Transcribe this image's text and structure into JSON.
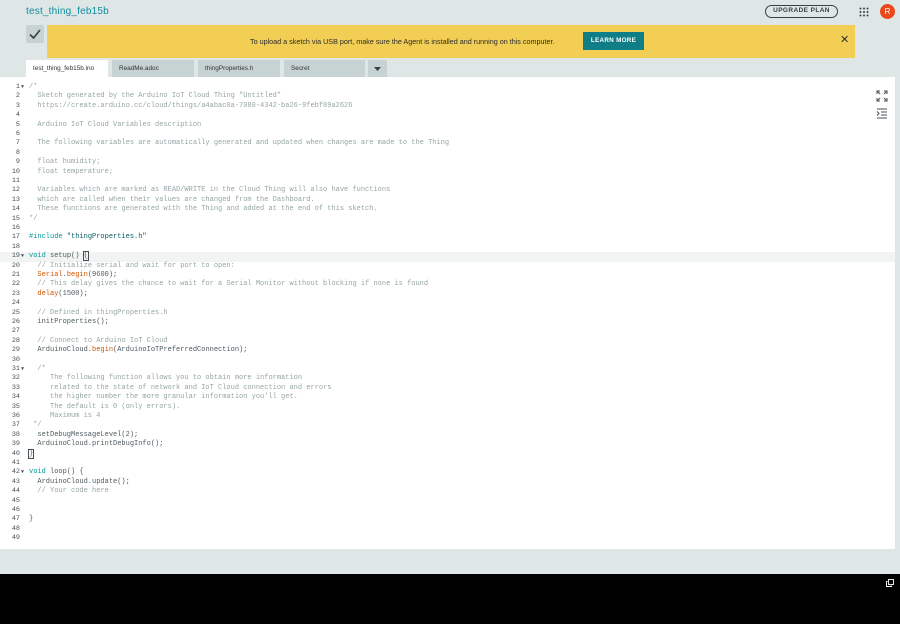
{
  "app": {
    "title": "test_thing_feb15b"
  },
  "header": {
    "upgrade_label": "UPGRADE PLAN",
    "avatar_initial": "R"
  },
  "banner": {
    "message": "To upload a sketch via USB port, make sure the Agent is installed and running on this computer.",
    "learn_more_label": "LEARN MORE",
    "close_label": "✕"
  },
  "tabs": [
    {
      "label": "test_thing_feb15b.ino"
    },
    {
      "label": "ReadMe.adoc"
    },
    {
      "label": "thingProperties.h"
    },
    {
      "label": "Secret"
    }
  ],
  "colors": {
    "accent": "#0f8ea1",
    "banner_bg": "#f2cf54",
    "learn_more_bg": "#0f7e86",
    "avatar_bg": "#e9491a",
    "comment": "#95a5a6",
    "keyword": "#00979c",
    "function": "#d35400"
  },
  "icons": {
    "verify": "check-icon",
    "apps": "grid-dots-icon",
    "tab_menu": "chevron-down-icon",
    "expand": "expand-icon",
    "indent": "indent-icon",
    "copy": "copy-icon"
  },
  "code": [
    "/*",
    "  Sketch generated by the Arduino IoT Cloud Thing \"Untitled\"",
    "  https://create.arduino.cc/cloud/things/a4abac0a-7080-4342-ba26-9febf89a2626",
    "",
    "  Arduino IoT Cloud Variables description",
    "",
    "  The following variables are automatically generated and updated when changes are made to the Thing",
    "",
    "  float humidity;",
    "  float temperature;",
    "",
    "  Variables which are marked as READ/WRITE in the Cloud Thing will also have functions",
    "  which are called when their values are changed from the Dashboard.",
    "  These functions are generated with the Thing and added at the end of this sketch.",
    "*/",
    "",
    "#include \"thingProperties.h\"",
    "",
    "void setup() {",
    "  // Initialize serial and wait for port to open:",
    "  Serial.begin(9600);",
    "  // This delay gives the chance to wait for a Serial Monitor without blocking if none is found",
    "  delay(1500);",
    "",
    "  // Defined in thingProperties.h",
    "  initProperties();",
    "",
    "  // Connect to Arduino IoT Cloud",
    "  ArduinoCloud.begin(ArduinoIoTPreferredConnection);",
    "",
    "  /*",
    "     The following function allows you to obtain more information",
    "     related to the state of network and IoT Cloud connection and errors",
    "     the higher number the more granular information you'll get.",
    "     The default is 0 (only errors).",
    "     Maximum is 4",
    " */",
    "  setDebugMessageLevel(2);",
    "  ArduinoCloud.printDebugInfo();",
    "}",
    "",
    "void loop() {",
    "  ArduinoCloud.update();",
    "  // Your code here",
    "",
    "",
    "}",
    "",
    ""
  ]
}
